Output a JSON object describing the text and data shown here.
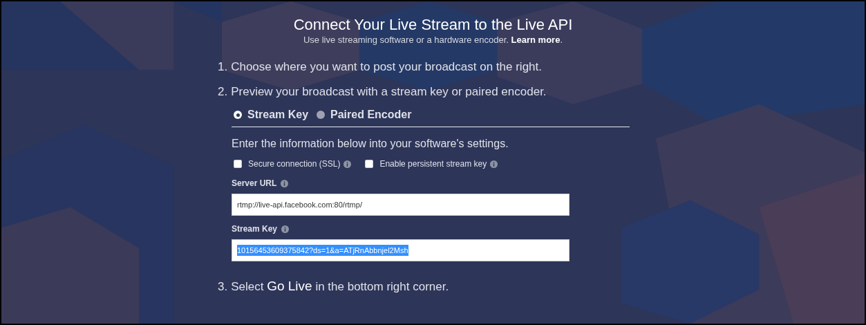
{
  "header": {
    "title": "Connect Your Live Stream to the Live API",
    "subtitle": "Use live streaming software or a hardware encoder. **Learn more**."
  },
  "steps": [
    {
      "number": "1.",
      "text": "Choose where you want to post your broadcast on the right."
    },
    {
      "number": "2.",
      "text": "Preview your broadcast with a stream key or paired encoder."
    }
  ],
  "modes": [
    {
      "label": "Stream Key",
      "selected": true
    },
    {
      "label": "Paired Encoder",
      "selected": false
    }
  ],
  "instructions": "Enter the information below into your software's settings.",
  "options": [
    {
      "label": "Secure connection (SSL)",
      "checked": false
    },
    {
      "label": "Enable persistent stream key",
      "checked": false
    }
  ],
  "fields": [
    {
      "label": "Server URL",
      "value": "rtmp://live-api.facebook.com:80/rtmp/",
      "text_selected": false
    },
    {
      "label": "Stream Key",
      "value": "10156453609375842?ds=1&a=ATjRnAbbnjel2Msh",
      "text_selected": true
    }
  ],
  "final_step": {
    "number": "3.",
    "text": "Select **Go Live** in the bottom right corner."
  }
}
